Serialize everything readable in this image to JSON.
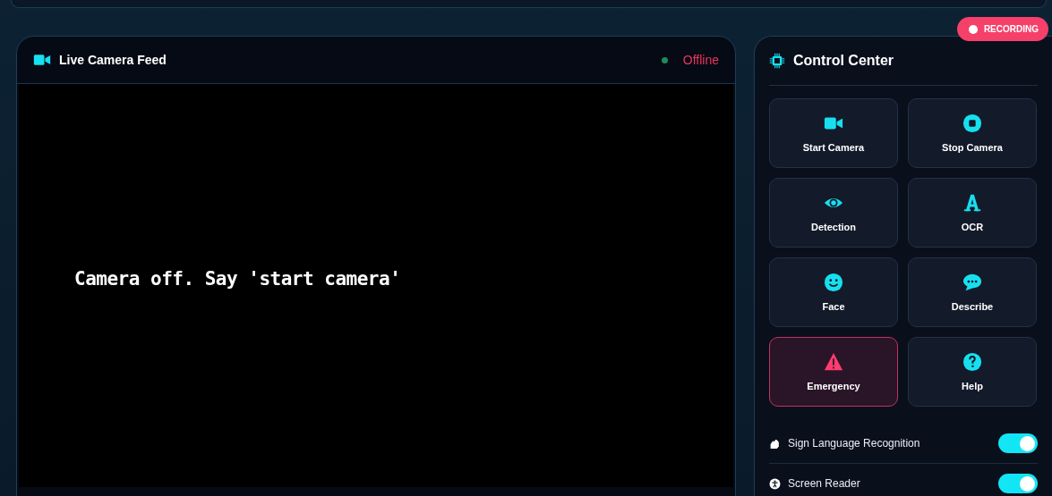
{
  "camera_panel": {
    "title": "Live Camera Feed",
    "status": {
      "label": "Offline",
      "color": "#1f8a5c"
    },
    "feed_message": "Camera off. Say 'start camera'"
  },
  "recording_badge": {
    "label": "RECORDING"
  },
  "control_panel": {
    "title": "Control Center",
    "buttons": [
      {
        "label": "Start Camera",
        "kind": "normal"
      },
      {
        "label": "Stop Camera",
        "kind": "normal"
      },
      {
        "label": "Detection",
        "kind": "normal"
      },
      {
        "label": "OCR",
        "kind": "normal"
      },
      {
        "label": "Face",
        "kind": "normal"
      },
      {
        "label": "Describe",
        "kind": "normal"
      },
      {
        "label": "Emergency",
        "kind": "danger"
      },
      {
        "label": "Help",
        "kind": "normal"
      }
    ],
    "toggles": [
      {
        "label": "Sign Language Recognition",
        "on": true
      },
      {
        "label": "Screen Reader",
        "on": true
      }
    ]
  }
}
